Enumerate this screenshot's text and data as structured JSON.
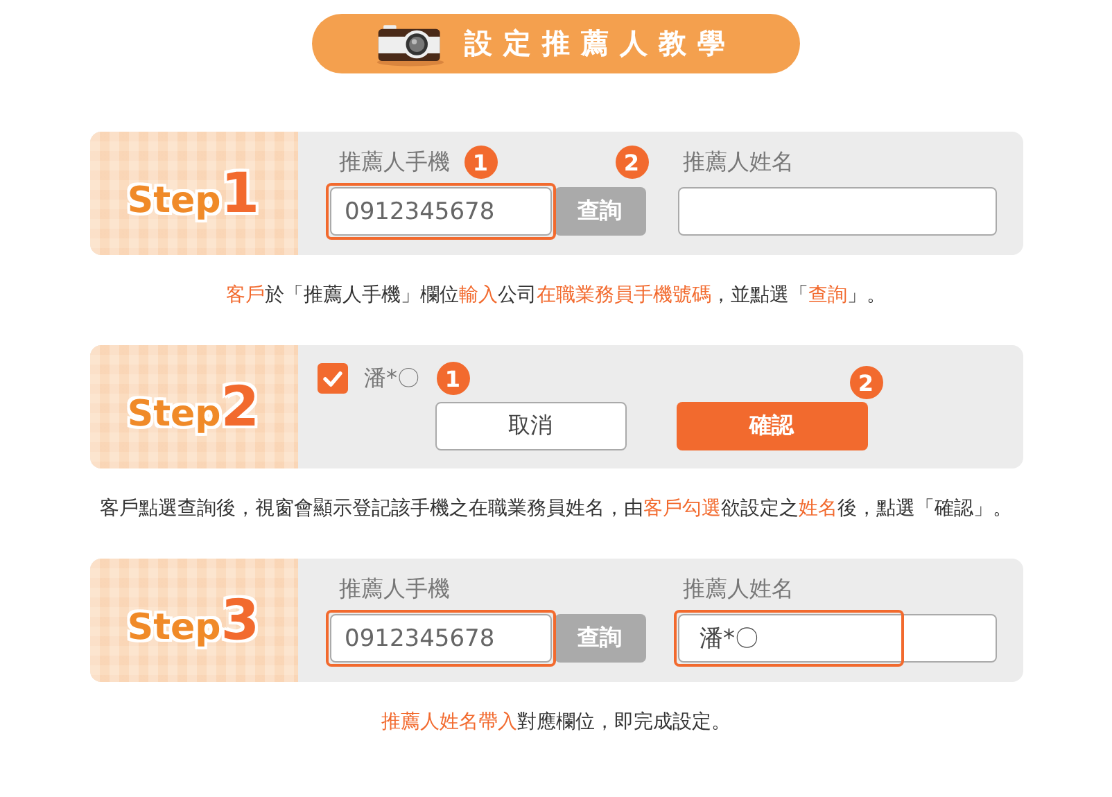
{
  "title": "設定推薦人教學",
  "steps": [
    {
      "kind": "form",
      "step_word": "Step",
      "number": "1",
      "phone_label": "推薦人手機",
      "phone_value": "0912345678",
      "query_button": "查詢",
      "name_label": "推薦人姓名",
      "phone_highlighted": true,
      "name_highlighted": false,
      "markers": [
        "1",
        "2"
      ],
      "caption": [
        {
          "text": "客戶",
          "highlight": true
        },
        {
          "text": "於「推薦人手機」欄位",
          "highlight": false
        },
        {
          "text": "輸入",
          "highlight": true
        },
        {
          "text": "公司",
          "highlight": false
        },
        {
          "text": "在職業務員手機號碼",
          "highlight": true
        },
        {
          "text": "，並點選「",
          "highlight": false
        },
        {
          "text": "查詢",
          "highlight": true
        },
        {
          "text": "」。",
          "highlight": false
        }
      ]
    },
    {
      "kind": "confirm",
      "step_word": "Step",
      "number": "2",
      "checked": true,
      "name": "潘*〇",
      "cancel_button": "取消",
      "confirm_button": "確認",
      "markers": [
        "1",
        "2"
      ],
      "caption": [
        {
          "text": "客戶點選查詢後，視窗會顯示登記該手機之在職業務員姓名，由",
          "highlight": false
        },
        {
          "text": "客戶勾選",
          "highlight": true
        },
        {
          "text": "欲設定之",
          "highlight": false
        },
        {
          "text": "姓名",
          "highlight": true
        },
        {
          "text": "後，點選「確認」。",
          "highlight": false
        }
      ]
    },
    {
      "kind": "form",
      "step_word": "Step",
      "number": "3",
      "phone_label": "推薦人手機",
      "phone_value": "0912345678",
      "query_button": "查詢",
      "name_label": "推薦人姓名",
      "name_value": "潘*〇",
      "phone_highlighted": true,
      "name_highlighted": true,
      "caption": [
        {
          "text": "推薦人姓名帶入",
          "highlight": true
        },
        {
          "text": "對應欄位，即完成設定。",
          "highlight": false
        }
      ]
    }
  ]
}
